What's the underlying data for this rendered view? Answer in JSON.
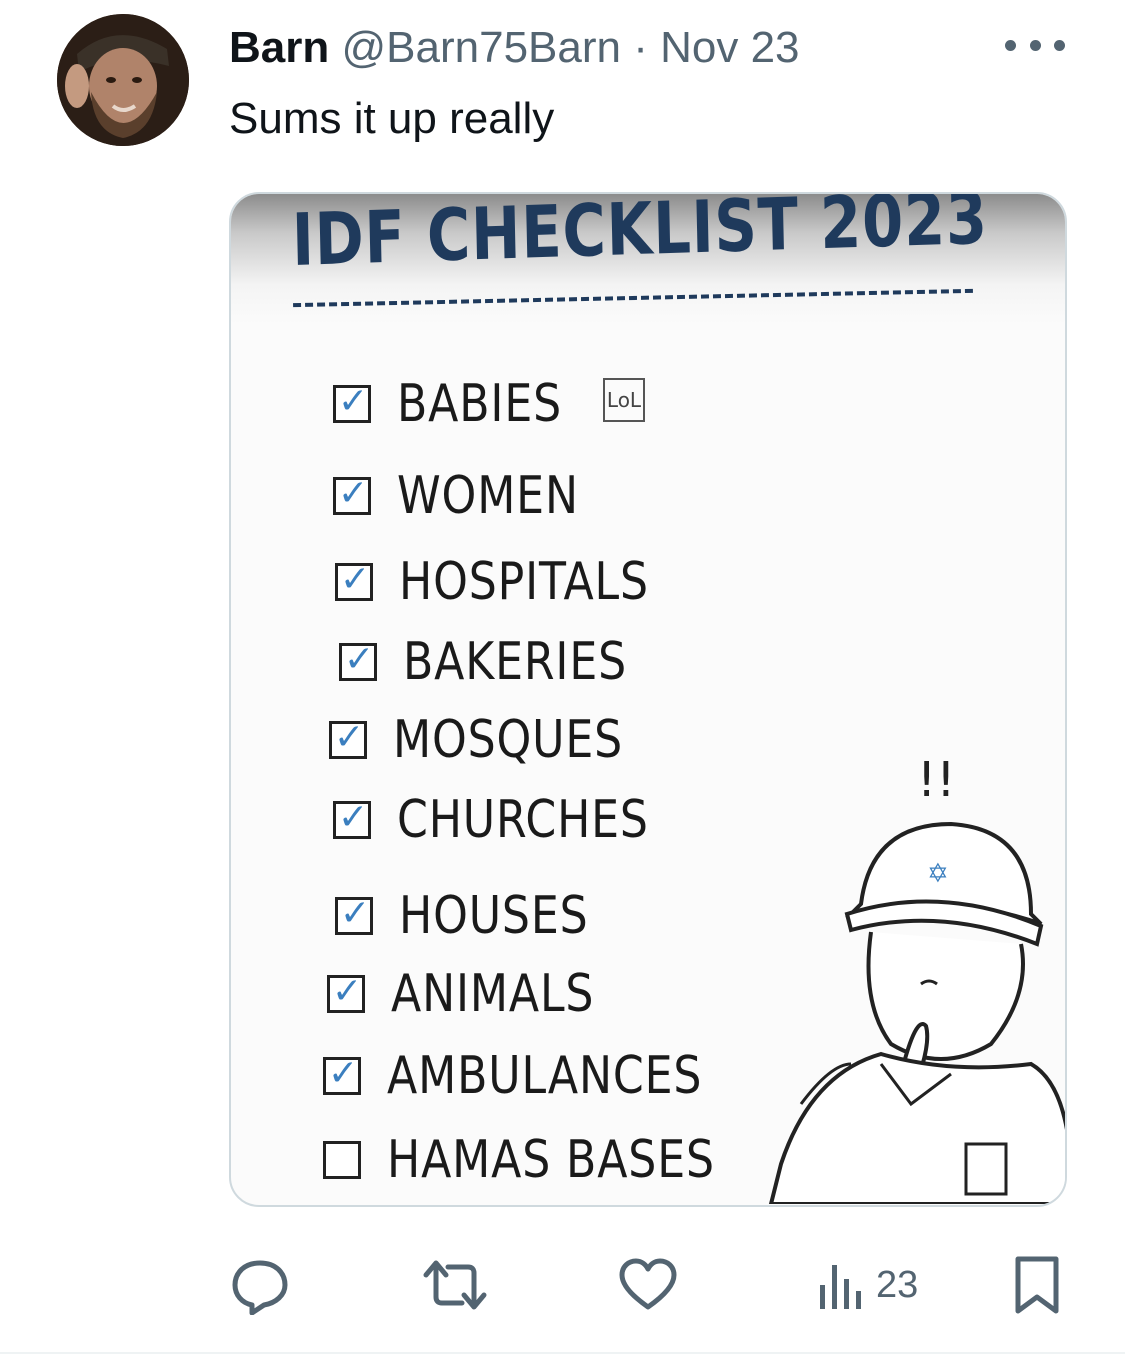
{
  "author": {
    "name": "Barn",
    "handle": "@Barn75Barn",
    "separator": "·",
    "date": "Nov 23"
  },
  "tweet": {
    "text": "Sums it up really"
  },
  "media": {
    "title": "IDF CHECKLIST 2023",
    "lol_box": "LoL",
    "exclaim": "!!",
    "items": [
      {
        "label": "BABIES",
        "checked": true
      },
      {
        "label": "WOMEN",
        "checked": true
      },
      {
        "label": "HOSPITALS",
        "checked": true
      },
      {
        "label": "BAKERIES",
        "checked": true
      },
      {
        "label": "MOSQUES",
        "checked": true
      },
      {
        "label": "CHURCHES",
        "checked": true
      },
      {
        "label": "HOUSES",
        "checked": true
      },
      {
        "label": "ANIMALS",
        "checked": true
      },
      {
        "label": "AMBULANCES",
        "checked": true
      },
      {
        "label": "HAMAS BASES",
        "checked": false
      }
    ],
    "check_glyph": "✓"
  },
  "actions": {
    "reply_icon": "reply-icon",
    "retweet_icon": "retweet-icon",
    "like_icon": "heart-icon",
    "views_icon": "views-icon",
    "views_count": "23",
    "bookmark_icon": "bookmark-icon"
  },
  "colors": {
    "text_primary": "#0f1419",
    "text_secondary": "#536471",
    "border": "#cfd9de",
    "check_blue": "#3b7fbf",
    "title_navy": "#1f3a5c"
  }
}
